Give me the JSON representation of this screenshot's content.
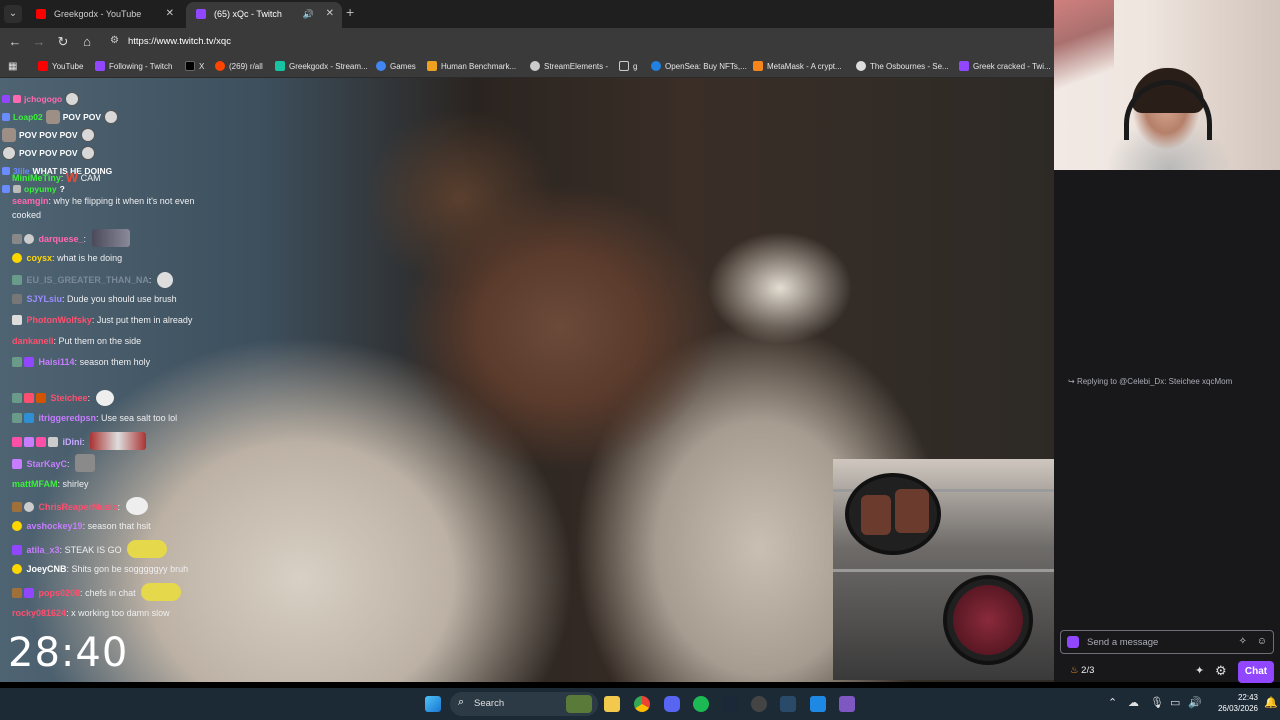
{
  "browser": {
    "tabs": [
      {
        "label": "Greekgodx - YouTube",
        "active": false,
        "favicon_color": "#ff0000"
      },
      {
        "label": "(65) xQc - Twitch",
        "active": true,
        "favicon_color": "#9147ff"
      }
    ],
    "close_glyph": "✕",
    "new_tab_glyph": "+",
    "url": "https://www.twitch.tv/xqc",
    "bookmarks": [
      {
        "label": "YouTube",
        "color": "#ff0000"
      },
      {
        "label": "Following - Twitch",
        "color": "#9147ff"
      },
      {
        "label": "X",
        "color": "#000000"
      },
      {
        "label": "(269) r/all",
        "color": "#ff4500"
      },
      {
        "label": "Greekgodx - Stream...",
        "color": "#17c3a3"
      },
      {
        "label": "Games",
        "color": "#4285f4"
      },
      {
        "label": "Human Benchmark...",
        "color": "#f0a020"
      },
      {
        "label": "StreamElements -",
        "color": "#cccccc"
      },
      {
        "label": "g",
        "color": "#444444"
      },
      {
        "label": "OpenSea: Buy NFTs,...",
        "color": "#2081e2"
      },
      {
        "label": "MetaMask - A crypt...",
        "color": "#f6851b"
      },
      {
        "label": "The Osbournes - Se...",
        "color": "#dddddd"
      },
      {
        "label": "Greek cracked - Twi...",
        "color": "#9147ff"
      }
    ]
  },
  "video": {
    "timer": "28:40",
    "overlay_chat": [
      {
        "user": "jchogogo",
        "color": "#ff69b4",
        "text": ""
      },
      {
        "user": "Loap02",
        "color": "#3cf03c",
        "text": "POV POV"
      },
      {
        "user": "",
        "color": "#ffffff",
        "text": "POV POV POV"
      },
      {
        "user": "",
        "color": "#ffffff",
        "text": "POV POV POV"
      },
      {
        "user": "3lile",
        "color": "#6b8cff",
        "text": "WHAT IS HE DOING"
      },
      {
        "user": "opyumy",
        "color": "#3cf03c",
        "text": "?"
      }
    ]
  },
  "chat": {
    "messages": [
      {
        "user": "MiniMeTiny",
        "color": "#3cf03c",
        "text": "CAM",
        "emote": "W"
      },
      {
        "user": "seamgin",
        "color": "#ff69b4",
        "text": "why he flipping it when it's not even cooked"
      },
      {
        "user": "darquese_",
        "color": "#ff69b4",
        "text": ""
      },
      {
        "user": "coysx",
        "color": "#ffd700",
        "text": "what is he doing"
      },
      {
        "user": "EU_IS_GREATER_THAN_NA",
        "color": "#7a8a9a",
        "text": ""
      },
      {
        "user": "SJYLsiu",
        "color": "#9c8cff",
        "text": "Dude you should use brush"
      },
      {
        "user": "PhotonWolfsky",
        "color": "#ff4f6f",
        "text": "Just put them in already"
      },
      {
        "user": "dankaneli",
        "color": "#ff4f6f",
        "text": "Put them on the side"
      },
      {
        "user": "Haisi114",
        "color": "#c77dff",
        "text": "season them holy"
      },
      {
        "user": "Steichee",
        "color": "#ff4f6f",
        "text": "",
        "reply": "Replying to @Celebi_Dx: Steichee xqcMom"
      },
      {
        "user": "itriggeredpsn",
        "color": "#c77dff",
        "text": "Use sea salt too lol"
      },
      {
        "user": "iDini",
        "color": "#c8a8ff",
        "text": ""
      },
      {
        "user": "StarKayC",
        "color": "#c77dff",
        "text": ""
      },
      {
        "user": "mattMFAM",
        "color": "#3cf03c",
        "text": "shirley"
      },
      {
        "user": "ChrisReaperMusic",
        "color": "#ff4f6f",
        "text": ""
      },
      {
        "user": "avshockey19",
        "color": "#c77dff",
        "text": "season that hsit"
      },
      {
        "user": "atila_x3",
        "color": "#c77dff",
        "text": "STEAK IS GO"
      },
      {
        "user": "JoeyCNB",
        "color": "#ffffff",
        "text": "Shits gon be sogggggyy bruh"
      },
      {
        "user": "pops0208",
        "color": "#ff4f6f",
        "text": "chefs in chat"
      },
      {
        "user": "rocky081624",
        "color": "#ff4f6f",
        "text": "x working too damn slow"
      }
    ],
    "input_placeholder": "Send a message",
    "points": "2/3",
    "chat_button": "Chat"
  },
  "taskbar": {
    "search_label": "Search",
    "time": "22:43",
    "date": "26/03/2026"
  }
}
